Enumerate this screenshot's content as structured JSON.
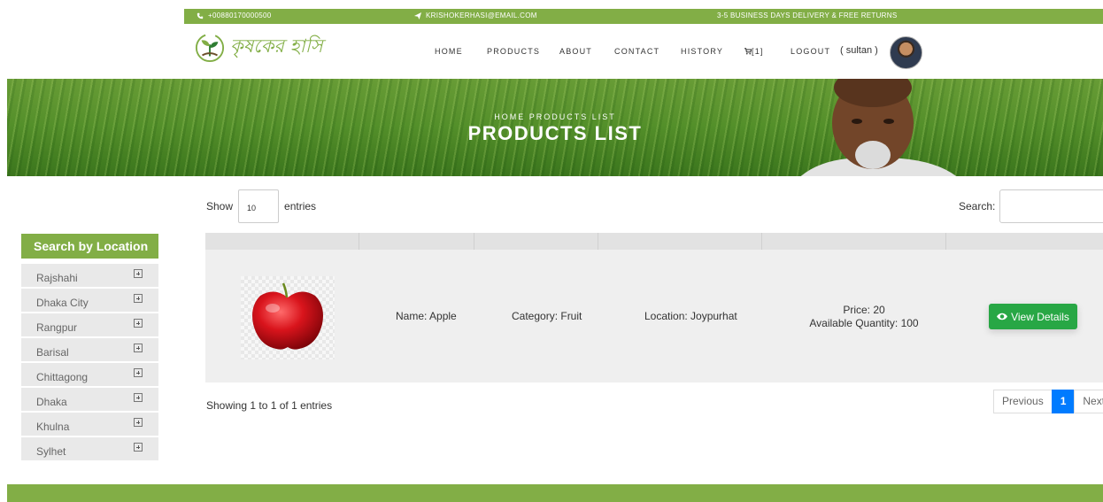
{
  "topbar": {
    "phone": "+00880170000500",
    "email": "KRISHOKERHASI@EMAIL.COM",
    "shipping": "3-5 BUSINESS DAYS DELIVERY & FREE RETURNS"
  },
  "brand": {
    "name": "কৃষকের হাসি"
  },
  "nav": {
    "items": [
      "HOME",
      "PRODUCTS",
      "ABOUT",
      "CONTACT",
      "HISTORY"
    ],
    "cart": "[1]",
    "logout": "LOGOUT",
    "user": "( sultan )"
  },
  "hero": {
    "breadcrumb": "HOME  PRODUCTS LIST",
    "title": "PRODUCTS LIST"
  },
  "sidebar": {
    "title": "Search by Location",
    "locations": [
      "Rajshahi",
      "Dhaka City",
      "Rangpur",
      "Barisal",
      "Chittagong",
      "Dhaka",
      "Khulna",
      "Sylhet"
    ]
  },
  "table": {
    "show_label": "Show",
    "length_value": "10",
    "entries_label": "entries",
    "search_label": "Search:",
    "rows": [
      {
        "name": "Name: Apple",
        "category": "Category: Fruit",
        "location": "Location: Joypurhat",
        "price": "Price: 20",
        "quantity": "Available Quantity: 100",
        "action": "View Details"
      }
    ],
    "info": "Showing 1 to 1 of 1 entries",
    "pagination": {
      "previous": "Previous",
      "current": "1",
      "next": "Next"
    }
  },
  "colors": {
    "brand_green": "#82ae46",
    "button_green": "#28a745",
    "page_active": "#007bff"
  }
}
